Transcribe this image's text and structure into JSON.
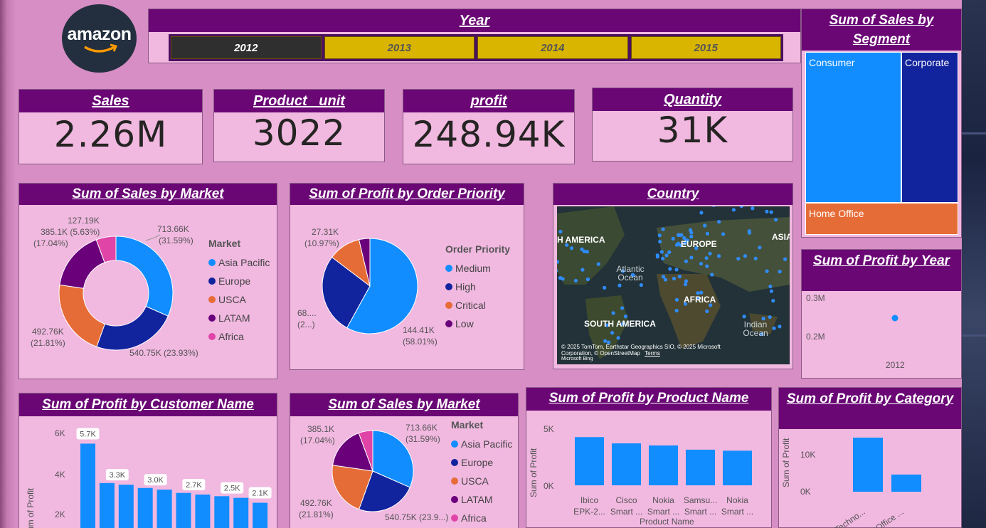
{
  "logo": {
    "text": "amazon"
  },
  "year_slicer": {
    "title": "Year",
    "options": [
      {
        "label": "2012",
        "selected": true
      },
      {
        "label": "2013",
        "selected": false
      },
      {
        "label": "2014",
        "selected": false
      },
      {
        "label": "2015",
        "selected": false
      }
    ]
  },
  "kpis": [
    {
      "title": "Sales",
      "value": "2.26M"
    },
    {
      "title": "Product   unit",
      "value": "3022"
    },
    {
      "title": "profit",
      "value": "248.94K"
    },
    {
      "title": "Quantity",
      "value": "31K"
    }
  ],
  "colors": {
    "header": "#6a0775",
    "card_bg": "#f1b8e0",
    "page_bg": "#d68ec4",
    "asia_pacific": "#118dff",
    "europe": "#12239e",
    "usca": "#e66c37",
    "latam": "#6b007b",
    "africa": "#e044a7",
    "tile": "#d9b500",
    "tile_selected": "#2f2f2f"
  },
  "sales_by_market_donut": {
    "title": "Sum of Sales by Market",
    "legend_title": "Market",
    "legend": [
      "Asia Pacific",
      "Europe",
      "USCA",
      "LATAM",
      "Africa"
    ],
    "labels": {
      "asia": [
        "713.66K",
        "(31.59%)"
      ],
      "europe": [
        "540.75K (23.93%)"
      ],
      "usca": [
        "492.76K",
        "(21.81%)"
      ],
      "latam": [
        "385.1K (5.63%)",
        "(17.04%)"
      ],
      "africa": [
        "127.19K"
      ]
    }
  },
  "profit_by_priority": {
    "title": "Sum of Profit by Order Priority",
    "legend_title": "Order Priority",
    "legend": [
      "Medium",
      "High",
      "Critical",
      "Low"
    ],
    "labels": {
      "medium": [
        "144.41K",
        "(58.01%)"
      ],
      "high": [
        "68....",
        "(2...)"
      ],
      "critical": [
        "27.31K",
        "(10.97%)"
      ]
    }
  },
  "country_map": {
    "title": "Country",
    "labels": [
      "H AMERICA",
      "EUROPE",
      "ASIA",
      "AFRICA",
      "SOUTH AMERICA"
    ],
    "oceans": [
      "Atlantic Ocean",
      "Indian Ocean"
    ],
    "attribution": "© 2025 TomTom, Earthstar Geographics SIO, © 2025 Microsoft Corporation, © OpenStreetMap",
    "terms": "Terms",
    "brand": "Microsoft Bing"
  },
  "sales_by_segment": {
    "title": "Sum of Sales by Segment",
    "segments": [
      "Consumer",
      "Corporate",
      "Home Office"
    ]
  },
  "profit_by_year": {
    "title": "Sum of Profit by Year",
    "y_ticks": [
      "0.3M",
      "0.2M"
    ],
    "x_ticks": [
      "2012"
    ]
  },
  "profit_by_customer": {
    "title": "Sum of Profit by Customer Name",
    "ylabel": "Sum of Profit",
    "y_ticks": [
      "6K",
      "4K",
      "2K"
    ],
    "data_labels": [
      "5.7K",
      "3.3K",
      "3.0K",
      "2.7K",
      "2.5K",
      "2.1K"
    ]
  },
  "sales_by_market_pie": {
    "title": "Sum of Sales by Market",
    "legend_title": "Market",
    "legend": [
      "Asia Pacific",
      "Europe",
      "USCA",
      "LATAM",
      "Africa"
    ],
    "labels": {
      "asia": [
        "713.66K",
        "(31.59%)"
      ],
      "europe": [
        "540.75K (23.9...)"
      ],
      "usca": [
        "492.76K",
        "(21.81%)"
      ],
      "latam": [
        "385.1K",
        "(17.04%)"
      ]
    }
  },
  "profit_by_product": {
    "title": "Sum of Profit by Product Name",
    "ylabel": "Sum of Profit",
    "xlabel": "Product Name",
    "y_ticks": [
      "5K",
      "0K"
    ],
    "categories": [
      [
        "Ibico",
        "EPK-2..."
      ],
      [
        "Cisco",
        "Smart ..."
      ],
      [
        "Nokia",
        "Smart ..."
      ],
      [
        "Samsu...",
        "Smart ..."
      ],
      [
        "Nokia",
        "Smart ..."
      ]
    ]
  },
  "profit_by_category": {
    "title": "Sum of Profit by Category",
    "ylabel": "Sum of Profit",
    "y_ticks": [
      "10K",
      "0K"
    ],
    "categories": [
      "Techno...",
      "Office ..."
    ]
  },
  "chart_data": [
    {
      "type": "pie",
      "title": "Sum of Sales by Market",
      "donut": true,
      "categories": [
        "Asia Pacific",
        "Europe",
        "USCA",
        "LATAM",
        "Africa"
      ],
      "values": [
        713.66,
        540.75,
        492.76,
        385.1,
        127.19
      ]
    },
    {
      "type": "pie",
      "title": "Sum of Profit by Order Priority",
      "categories": [
        "Medium",
        "High",
        "Critical",
        "Low"
      ],
      "values": [
        144.41,
        68.0,
        27.31,
        9.2
      ]
    },
    {
      "type": "bar",
      "title": "Sum of Profit by Customer Name",
      "ylabel": "Sum of Profit",
      "values": [
        5.7,
        3.3,
        3.2,
        3.0,
        2.9,
        2.7,
        2.6,
        2.5,
        2.4,
        2.1
      ],
      "ylim": [
        0,
        6.5
      ]
    },
    {
      "type": "pie",
      "title": "Sum of Sales by Market",
      "categories": [
        "Asia Pacific",
        "Europe",
        "USCA",
        "LATAM",
        "Africa"
      ],
      "values": [
        713.66,
        540.75,
        492.76,
        385.1,
        127.19
      ]
    },
    {
      "type": "bar",
      "title": "Sum of Profit by Product Name",
      "xlabel": "Product Name",
      "ylabel": "Sum of Profit",
      "categories": [
        "Ibico EPK-2...",
        "Cisco Smart ...",
        "Nokia Smart ...",
        "Samsu... Smart ...",
        "Nokia Smart ..."
      ],
      "values": [
        4.6,
        4.0,
        3.8,
        3.4,
        3.3
      ],
      "ylim": [
        0,
        6
      ]
    },
    {
      "type": "bar",
      "title": "Sum of Profit by Category",
      "ylabel": "Sum of Profit",
      "categories": [
        "Techno...",
        "Office ..."
      ],
      "values": [
        14.5,
        4.6
      ],
      "ylim": [
        0,
        16
      ]
    },
    {
      "type": "scatter",
      "title": "Sum of Profit by Year",
      "x": [
        "2012"
      ],
      "y": [
        0.25
      ],
      "unit": "M"
    },
    {
      "type": "treemap",
      "title": "Sum of Sales by Segment",
      "categories": [
        "Consumer",
        "Corporate",
        "Home Office"
      ]
    }
  ]
}
